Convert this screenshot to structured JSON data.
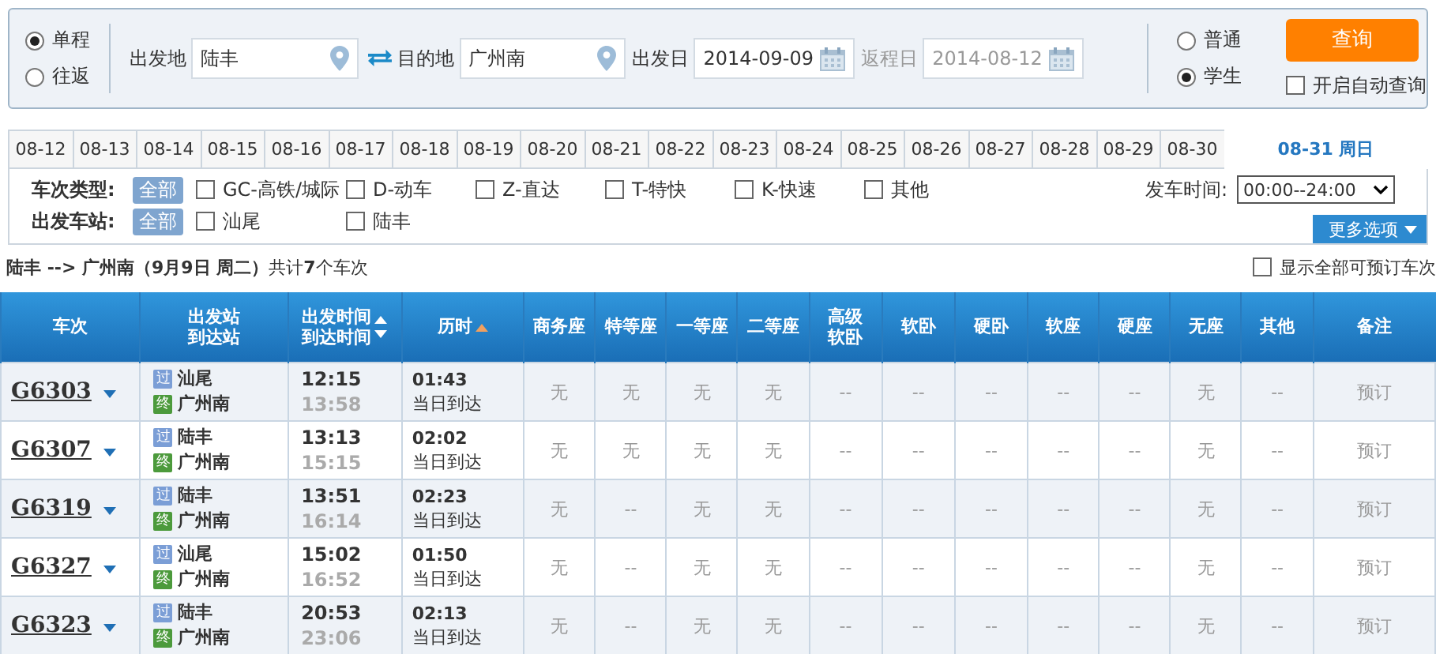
{
  "search": {
    "trip_type": [
      {
        "label": "单程",
        "selected": true
      },
      {
        "label": "往返",
        "selected": false
      }
    ],
    "from": {
      "label": "出发地",
      "value": "陆丰"
    },
    "to": {
      "label": "目的地",
      "value": "广州南"
    },
    "depart_date": {
      "label": "出发日",
      "value": "2014-09-09",
      "disabled": false
    },
    "return_date": {
      "label": "返程日",
      "value": "2014-08-12",
      "disabled": true
    },
    "passenger_type": [
      {
        "label": "普通",
        "selected": false
      },
      {
        "label": "学生",
        "selected": true
      }
    ],
    "query_button": "查询",
    "auto_query": {
      "label": "开启自动查询",
      "checked": false
    }
  },
  "date_tabs": [
    {
      "label": "08-12",
      "selected": false
    },
    {
      "label": "08-13",
      "selected": false
    },
    {
      "label": "08-14",
      "selected": false
    },
    {
      "label": "08-15",
      "selected": false
    },
    {
      "label": "08-16",
      "selected": false
    },
    {
      "label": "08-17",
      "selected": false
    },
    {
      "label": "08-18",
      "selected": false
    },
    {
      "label": "08-19",
      "selected": false
    },
    {
      "label": "08-20",
      "selected": false
    },
    {
      "label": "08-21",
      "selected": false
    },
    {
      "label": "08-22",
      "selected": false
    },
    {
      "label": "08-23",
      "selected": false
    },
    {
      "label": "08-24",
      "selected": false
    },
    {
      "label": "08-25",
      "selected": false
    },
    {
      "label": "08-26",
      "selected": false
    },
    {
      "label": "08-27",
      "selected": false
    },
    {
      "label": "08-28",
      "selected": false
    },
    {
      "label": "08-29",
      "selected": false
    },
    {
      "label": "08-30",
      "selected": false
    },
    {
      "label": "08-31 周日",
      "selected": true
    }
  ],
  "filters": {
    "train_types": {
      "label": "车次类型:",
      "all": "全部",
      "options": [
        {
          "label": "GC-高铁/城际",
          "checked": false
        },
        {
          "label": "D-动车",
          "checked": false
        },
        {
          "label": "Z-直达",
          "checked": false
        },
        {
          "label": "T-特快",
          "checked": false
        },
        {
          "label": "K-快速",
          "checked": false
        },
        {
          "label": "其他",
          "checked": false
        }
      ]
    },
    "stations": {
      "label": "出发车站:",
      "all": "全部",
      "options": [
        {
          "label": "汕尾",
          "checked": false
        },
        {
          "label": "陆丰",
          "checked": false
        }
      ]
    },
    "depart_time": {
      "label": "发车时间:",
      "value": "00:00--24:00"
    },
    "more_options": "更多选项"
  },
  "summary": {
    "text": "**陆丰 --> 广州南（9月9日 周二）**共计**7**个车次",
    "show_all": {
      "label": "显示全部可预订车次",
      "checked": false
    }
  },
  "table": {
    "columns": [
      {
        "lines": [
          "车次"
        ]
      },
      {
        "lines": [
          "出发站",
          "到达站"
        ]
      },
      {
        "lines": [
          "出发时间",
          "到达时间"
        ],
        "sortable": true
      },
      {
        "lines": [
          "历时"
        ],
        "sorted": true
      },
      {
        "lines": [
          "商务座"
        ]
      },
      {
        "lines": [
          "特等座"
        ]
      },
      {
        "lines": [
          "一等座"
        ]
      },
      {
        "lines": [
          "二等座"
        ]
      },
      {
        "lines": [
          "高级",
          "软卧"
        ]
      },
      {
        "lines": [
          "软卧"
        ]
      },
      {
        "lines": [
          "硬卧"
        ]
      },
      {
        "lines": [
          "软座"
        ]
      },
      {
        "lines": [
          "硬座"
        ]
      },
      {
        "lines": [
          "无座"
        ]
      },
      {
        "lines": [
          "其他"
        ]
      },
      {
        "lines": [
          "备注"
        ]
      }
    ],
    "rows": [
      {
        "train": "G6303",
        "from_badge": "过",
        "from": "汕尾",
        "to_badge": "终",
        "to": "广州南",
        "depart": "12:15",
        "arrive": "13:58",
        "duration": "01:43",
        "arrival_day": "当日到达",
        "seats": [
          "无",
          "无",
          "无",
          "无",
          "--",
          "--",
          "--",
          "--",
          "--",
          "无",
          "--"
        ],
        "remark": "预订"
      },
      {
        "train": "G6307",
        "from_badge": "过",
        "from": "陆丰",
        "to_badge": "终",
        "to": "广州南",
        "depart": "13:13",
        "arrive": "15:15",
        "duration": "02:02",
        "arrival_day": "当日到达",
        "seats": [
          "无",
          "无",
          "无",
          "无",
          "--",
          "--",
          "--",
          "--",
          "--",
          "无",
          "--"
        ],
        "remark": "预订"
      },
      {
        "train": "G6319",
        "from_badge": "过",
        "from": "陆丰",
        "to_badge": "终",
        "to": "广州南",
        "depart": "13:51",
        "arrive": "16:14",
        "duration": "02:23",
        "arrival_day": "当日到达",
        "seats": [
          "无",
          "--",
          "无",
          "无",
          "--",
          "--",
          "--",
          "--",
          "--",
          "无",
          "--"
        ],
        "remark": "预订"
      },
      {
        "train": "G6327",
        "from_badge": "过",
        "from": "汕尾",
        "to_badge": "终",
        "to": "广州南",
        "depart": "15:02",
        "arrive": "16:52",
        "duration": "01:50",
        "arrival_day": "当日到达",
        "seats": [
          "无",
          "--",
          "无",
          "无",
          "--",
          "--",
          "--",
          "--",
          "--",
          "无",
          "--"
        ],
        "remark": "预订"
      },
      {
        "train": "G6323",
        "from_badge": "过",
        "from": "陆丰",
        "to_badge": "终",
        "to": "广州南",
        "depart": "20:53",
        "arrive": "23:06",
        "duration": "02:13",
        "arrival_day": "当日到达",
        "seats": [
          "无",
          "--",
          "无",
          "无",
          "--",
          "--",
          "--",
          "--",
          "--",
          "无",
          "--"
        ],
        "remark": "预订"
      }
    ]
  }
}
